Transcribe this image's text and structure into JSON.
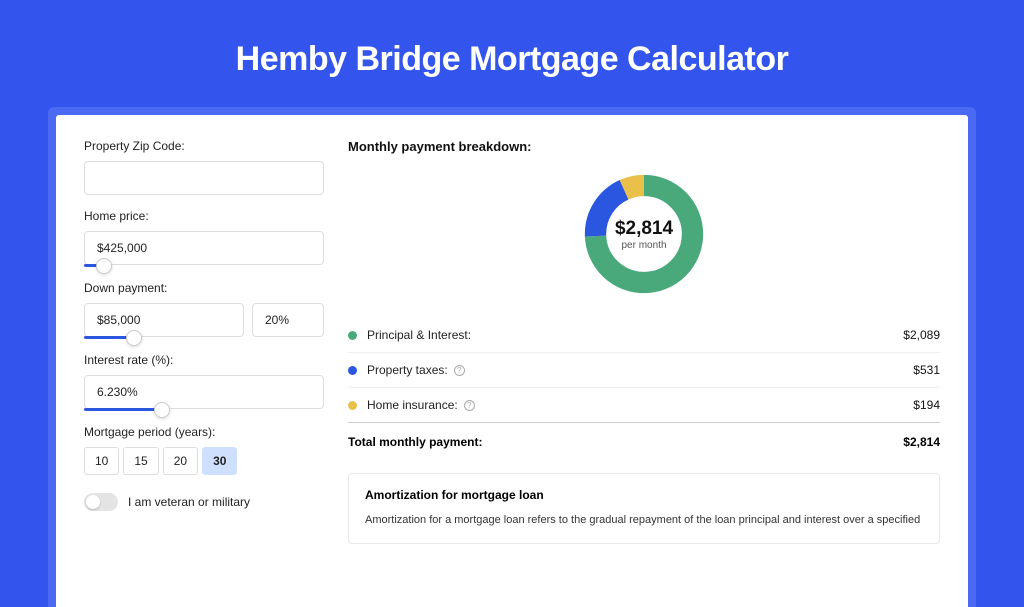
{
  "title": "Hemby Bridge Mortgage Calculator",
  "form": {
    "zip_label": "Property Zip Code:",
    "zip_value": "",
    "home_price_label": "Home price:",
    "home_price_value": "$425,000",
    "down_payment_label": "Down payment:",
    "down_payment_value": "$85,000",
    "down_payment_pct": "20%",
    "interest_label": "Interest rate (%):",
    "interest_value": "6.230%",
    "period_label": "Mortgage period (years):",
    "periods": [
      "10",
      "15",
      "20",
      "30"
    ],
    "period_selected": "30",
    "veteran_label": "I am veteran or military"
  },
  "breakdown": {
    "title": "Monthly payment breakdown:",
    "center_value": "$2,814",
    "center_sub": "per month",
    "items": [
      {
        "color": "green",
        "label": "Principal & Interest:",
        "value": "$2,089",
        "info": false
      },
      {
        "color": "blue",
        "label": "Property taxes:",
        "value": "$531",
        "info": true
      },
      {
        "color": "yellow",
        "label": "Home insurance:",
        "value": "$194",
        "info": true
      }
    ],
    "total_label": "Total monthly payment:",
    "total_value": "$2,814"
  },
  "amort": {
    "title": "Amortization for mortgage loan",
    "text": "Amortization for a mortgage loan refers to the gradual repayment of the loan principal and interest over a specified"
  },
  "chart_data": {
    "type": "pie",
    "title": "Monthly payment breakdown",
    "series": [
      {
        "name": "Principal & Interest",
        "value": 2089,
        "color": "#4aa97b"
      },
      {
        "name": "Property taxes",
        "value": 531,
        "color": "#2b57e0"
      },
      {
        "name": "Home insurance",
        "value": 194,
        "color": "#e8c04a"
      }
    ],
    "total": 2814
  }
}
